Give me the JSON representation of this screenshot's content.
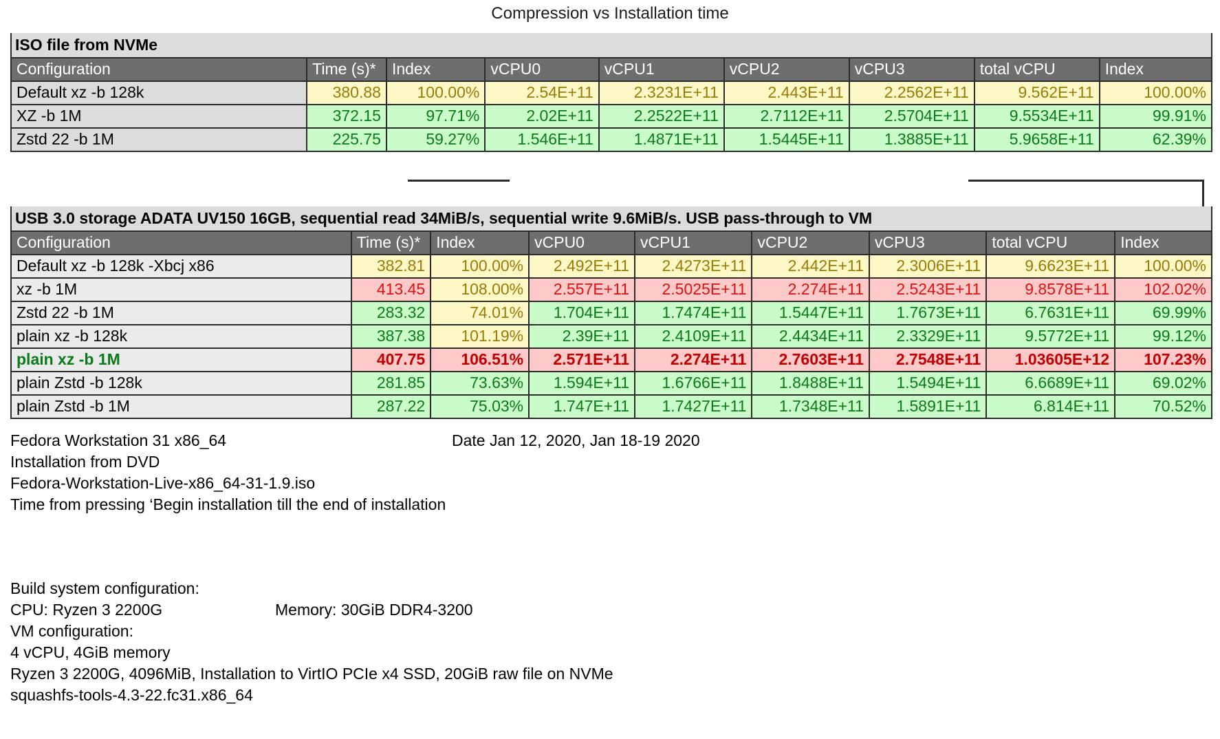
{
  "title": "Compression vs Installation time",
  "columns": [
    "Configuration",
    "Time (s)*",
    "Index",
    "vCPU0",
    "vCPU1",
    "vCPU2",
    "vCPU3",
    "total vCPU",
    "Index"
  ],
  "tables": [
    {
      "section_title": "ISO file from NVMe",
      "rows": [
        {
          "cells": [
            "Default xz -b 128k",
            "380.88",
            "100.00%",
            "2.54E+11",
            "2.3231E+11",
            "2.443E+11",
            "2.2562E+11",
            "9.562E+11",
            "100.00%"
          ],
          "bg": [
            "gray",
            "yellow",
            "yellow",
            "yellow",
            "yellow",
            "yellow",
            "yellow",
            "yellow",
            "yellow"
          ],
          "fg": [
            "dark",
            "yellow",
            "yellow",
            "yellow",
            "yellow",
            "yellow",
            "yellow",
            "yellow",
            "yellow"
          ],
          "bold": false
        },
        {
          "cells": [
            "XZ -b 1M",
            "372.15",
            "97.71%",
            "2.02E+11",
            "2.2522E+11",
            "2.7112E+11",
            "2.5704E+11",
            "9.5534E+11",
            "99.91%"
          ],
          "bg": [
            "gray",
            "green",
            "green",
            "green",
            "green",
            "green",
            "green",
            "green",
            "green"
          ],
          "fg": [
            "dark",
            "green",
            "green",
            "green",
            "green",
            "green",
            "green",
            "green",
            "green"
          ],
          "bold": false
        },
        {
          "cells": [
            "Zstd 22 -b 1M",
            "225.75",
            "59.27%",
            "1.546E+11",
            "1.4871E+11",
            "1.5445E+11",
            "1.3885E+11",
            "5.9658E+11",
            "62.39%"
          ],
          "bg": [
            "gray",
            "green",
            "green",
            "green",
            "green",
            "green",
            "green",
            "green",
            "green"
          ],
          "fg": [
            "dark",
            "green",
            "green",
            "green",
            "green",
            "green",
            "green",
            "green",
            "green"
          ],
          "bold": false
        }
      ]
    },
    {
      "section_title": "USB 3.0 storage ADATA UV150 16GB, sequential read 34MiB/s, sequential write 9.6MiB/s. USB pass-through to VM",
      "rows": [
        {
          "cells": [
            "Default xz -b 128k -Xbcj x86",
            "382.81",
            "100.00%",
            "2.492E+11",
            "2.4273E+11",
            "2.442E+11",
            "2.3006E+11",
            "9.6623E+11",
            "100.00%"
          ],
          "bg": [
            "gray",
            "yellow",
            "yellow",
            "yellow",
            "yellow",
            "yellow",
            "yellow",
            "yellow",
            "yellow"
          ],
          "fg": [
            "dark",
            "yellow",
            "yellow",
            "yellow",
            "yellow",
            "yellow",
            "yellow",
            "yellow",
            "yellow"
          ],
          "bold": false
        },
        {
          "cells": [
            "xz -b 1M",
            "413.45",
            "108.00%",
            "2.557E+11",
            "2.5025E+11",
            "2.274E+11",
            "2.5243E+11",
            "9.8578E+11",
            "102.02%"
          ],
          "bg": [
            "gray",
            "red",
            "yellow",
            "red",
            "red",
            "red",
            "red",
            "red",
            "red"
          ],
          "fg": [
            "dark",
            "red",
            "yellow",
            "red",
            "red",
            "red",
            "red",
            "red",
            "red"
          ],
          "bold": false
        },
        {
          "cells": [
            "Zstd 22 -b 1M",
            "283.32",
            "74.01%",
            "1.704E+11",
            "1.7474E+11",
            "1.5447E+11",
            "1.7673E+11",
            "6.7631E+11",
            "69.99%"
          ],
          "bg": [
            "gray",
            "green",
            "yellow",
            "green",
            "green",
            "green",
            "green",
            "green",
            "green"
          ],
          "fg": [
            "dark",
            "green",
            "yellow",
            "green",
            "green",
            "green",
            "green",
            "green",
            "green"
          ],
          "bold": false
        },
        {
          "cells": [
            "plain xz -b 128k",
            "387.38",
            "101.19%",
            "2.39E+11",
            "2.4109E+11",
            "2.4434E+11",
            "2.3329E+11",
            "9.5772E+11",
            "99.12%"
          ],
          "bg": [
            "gray",
            "green",
            "yellow",
            "green",
            "green",
            "green",
            "green",
            "green",
            "green"
          ],
          "fg": [
            "dark",
            "green",
            "yellow",
            "green",
            "green",
            "green",
            "green",
            "green",
            "green"
          ],
          "bold": false
        },
        {
          "cells": [
            "plain xz -b 1M",
            "407.75",
            "106.51%",
            "2.571E+11",
            "2.274E+11",
            "2.7603E+11",
            "2.7548E+11",
            "1.03605E+12",
            "107.23%"
          ],
          "bg": [
            "green",
            "red",
            "red",
            "red",
            "red",
            "red",
            "red",
            "red",
            "red"
          ],
          "fg": [
            "greenbold",
            "redbold",
            "redbold",
            "redbold",
            "redbold",
            "redbold",
            "redbold",
            "redbold",
            "redbold"
          ],
          "bold": true
        },
        {
          "cells": [
            "plain Zstd -b 128k",
            "281.85",
            "73.63%",
            "1.594E+11",
            "1.6766E+11",
            "1.8488E+11",
            "1.5494E+11",
            "6.6689E+11",
            "69.02%"
          ],
          "bg": [
            "gray",
            "green",
            "green",
            "green",
            "green",
            "green",
            "green",
            "green",
            "green"
          ],
          "fg": [
            "dark",
            "green",
            "green",
            "green",
            "green",
            "green",
            "green",
            "green",
            "green"
          ],
          "bold": false
        },
        {
          "cells": [
            "plain Zstd -b 1M",
            "287.22",
            "75.03%",
            "1.747E+11",
            "1.7427E+11",
            "1.7348E+11",
            "1.5891E+11",
            "6.814E+11",
            "70.52%"
          ],
          "bg": [
            "gray",
            "green",
            "green",
            "green",
            "green",
            "green",
            "green",
            "green",
            "green"
          ],
          "fg": [
            "dark",
            "green",
            "green",
            "green",
            "green",
            "green",
            "green",
            "green",
            "green"
          ],
          "bold": false
        }
      ]
    }
  ],
  "notes": {
    "os": "Fedora Workstation 31 x86_64",
    "date": "Date Jan 12, 2020, Jan 18-19 2020",
    "install_from": "Installation from DVD",
    "iso_name": "Fedora-Workstation-Live-x86_64-31-1.9.iso",
    "time_note": "Time from pressing ‘Begin installation till the end of installation"
  },
  "build": {
    "heading": "Build system configuration:",
    "cpu": "CPU: Ryzen 3 2200G",
    "memory": "Memory: 30GiB DDR4-3200",
    "vm_heading": "VM configuration:",
    "vm_cpu": "4 vCPU, 4GiB memory",
    "vm_detail": "Ryzen 3 2200G, 4096MiB, Installation to VirtIO PCIe x4 SSD, 20GiB raw file on NVMe",
    "tools": "squashfs-tools-4.3-22.fc31.x86_64"
  },
  "colors": {
    "header_bg": "#6e6e6e",
    "section_bg": "#dcdcdc",
    "yellow_bg": "#fdf8c6",
    "green_bg": "#c9fcc9",
    "red_bg": "#fdc9c9",
    "yellow_fg": "#9a7b07",
    "green_fg": "#0b7a18",
    "red_fg": "#e01111",
    "redbold_fg": "#c00000",
    "border": "#2b2b2b"
  },
  "chart_data": {
    "type": "table",
    "title": "Compression vs Installation time",
    "columns": [
      "Configuration",
      "Time (s)*",
      "Index",
      "vCPU0",
      "vCPU1",
      "vCPU2",
      "vCPU3",
      "total vCPU",
      "Index"
    ],
    "groups": [
      {
        "name": "ISO file from NVMe",
        "rows": [
          [
            "Default xz -b 128k",
            380.88,
            "100.00%",
            254000000000.0,
            232310000000.0,
            244300000000.0,
            225620000000.0,
            956200000000.0,
            "100.00%"
          ],
          [
            "XZ -b 1M",
            372.15,
            "97.71%",
            202000000000.0,
            225220000000.0,
            271120000000.0,
            257040000000.0,
            955340000000.0,
            "99.91%"
          ],
          [
            "Zstd 22 -b 1M",
            225.75,
            "59.27%",
            154600000000.0,
            148710000000.0,
            154450000000.0,
            138850000000.0,
            596580000000.0,
            "62.39%"
          ]
        ]
      },
      {
        "name": "USB 3.0 storage ADATA UV150 16GB, sequential read 34MiB/s, sequential write 9.6MiB/s. USB pass-through to VM",
        "rows": [
          [
            "Default xz -b 128k -Xbcj x86",
            382.81,
            "100.00%",
            249200000000.0,
            242730000000.0,
            244200000000.0,
            230060000000.0,
            966230000000.0,
            "100.00%"
          ],
          [
            "xz -b 1M",
            413.45,
            "108.00%",
            255700000000.0,
            250250000000.0,
            227400000000.0,
            252430000000.0,
            985780000000.0,
            "102.02%"
          ],
          [
            "Zstd 22 -b 1M",
            283.32,
            "74.01%",
            170400000000.0,
            174740000000.0,
            154470000000.0,
            176730000000.0,
            676310000000.0,
            "69.99%"
          ],
          [
            "plain xz -b 128k",
            387.38,
            "101.19%",
            239000000000.0,
            241090000000.0,
            244340000000.0,
            233290000000.0,
            957720000000.0,
            "99.12%"
          ],
          [
            "plain xz -b 1M",
            407.75,
            "106.51%",
            257100000000.0,
            227400000000.0,
            276030000000.0,
            275480000000.0,
            1036050000000.0,
            "107.23%"
          ],
          [
            "plain Zstd -b 128k",
            281.85,
            "73.63%",
            159400000000.0,
            167660000000.0,
            184880000000.0,
            154940000000.0,
            666890000000.0,
            "69.02%"
          ],
          [
            "plain Zstd -b 1M",
            287.22,
            "75.03%",
            174700000000.0,
            174270000000.0,
            173480000000.0,
            158910000000.0,
            681400000000.0,
            "70.52%"
          ]
        ]
      }
    ],
    "ylabel": "",
    "xlabel": "",
    "grid": true,
    "legend": "none"
  }
}
